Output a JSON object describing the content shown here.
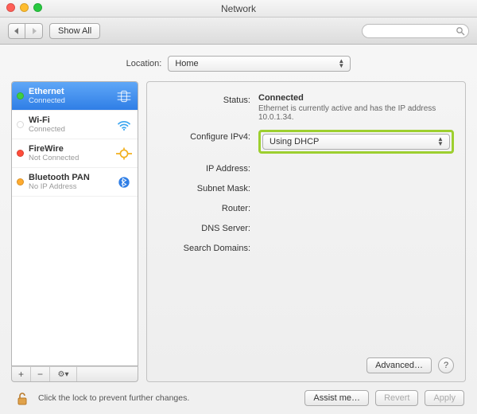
{
  "window": {
    "title": "Network"
  },
  "toolbar": {
    "show_all": "Show All",
    "search_placeholder": ""
  },
  "location": {
    "label": "Location:",
    "value": "Home"
  },
  "interfaces": [
    {
      "name": "Ethernet",
      "sub": "Connected",
      "status": "green",
      "icon": "ethernet",
      "selected": true
    },
    {
      "name": "Wi-Fi",
      "sub": "Connected",
      "status": "off",
      "icon": "wifi",
      "selected": false
    },
    {
      "name": "FireWire",
      "sub": "Not Connected",
      "status": "red",
      "icon": "firewire",
      "selected": false
    },
    {
      "name": "Bluetooth PAN",
      "sub": "No IP Address",
      "status": "orange",
      "icon": "bluetooth",
      "selected": false
    }
  ],
  "list_footer": {
    "add": "+",
    "remove": "−",
    "gear": "⚙︎▾"
  },
  "detail": {
    "status_label": "Status:",
    "status_value": "Connected",
    "status_desc": "Ethernet is currently active and has the IP address 10.0.1.34.",
    "configure_label": "Configure IPv4:",
    "configure_value": "Using DHCP",
    "ip_label": "IP Address:",
    "subnet_label": "Subnet Mask:",
    "router_label": "Router:",
    "dns_label": "DNS Server:",
    "domains_label": "Search Domains:",
    "advanced": "Advanced…",
    "help": "?"
  },
  "bottom": {
    "lock_msg": "Click the lock to prevent further changes.",
    "assist": "Assist me…",
    "revert": "Revert",
    "apply": "Apply"
  }
}
